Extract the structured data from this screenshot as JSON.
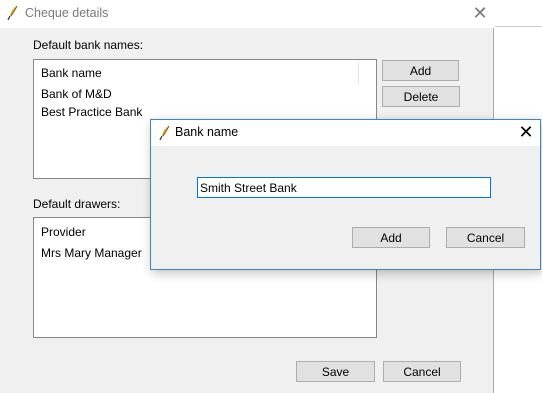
{
  "main_window": {
    "title": "Cheque details",
    "bank_names_label": "Default bank names:",
    "bank_list": {
      "header": "Bank name",
      "items": [
        "Bank of M&D",
        "Best Practice Bank"
      ]
    },
    "add_label": "Add",
    "delete_label": "Delete",
    "drawers_label": "Default drawers:",
    "drawers_list": {
      "header": "Provider",
      "items": [
        "Mrs Mary Manager"
      ]
    },
    "save_label": "Save",
    "cancel_label": "Cancel"
  },
  "dialog": {
    "title": "Bank name",
    "input_value": "Smith Street Bank",
    "add_label": "Add",
    "cancel_label": "Cancel"
  },
  "icons": {
    "app": "quill-pen-icon",
    "close": "close-icon"
  },
  "colors": {
    "window_bg": "#f0f0f0",
    "focus_border": "#0078d7",
    "dialog_border": "#3b86c9",
    "inactive_title": "#7a7a7a"
  }
}
